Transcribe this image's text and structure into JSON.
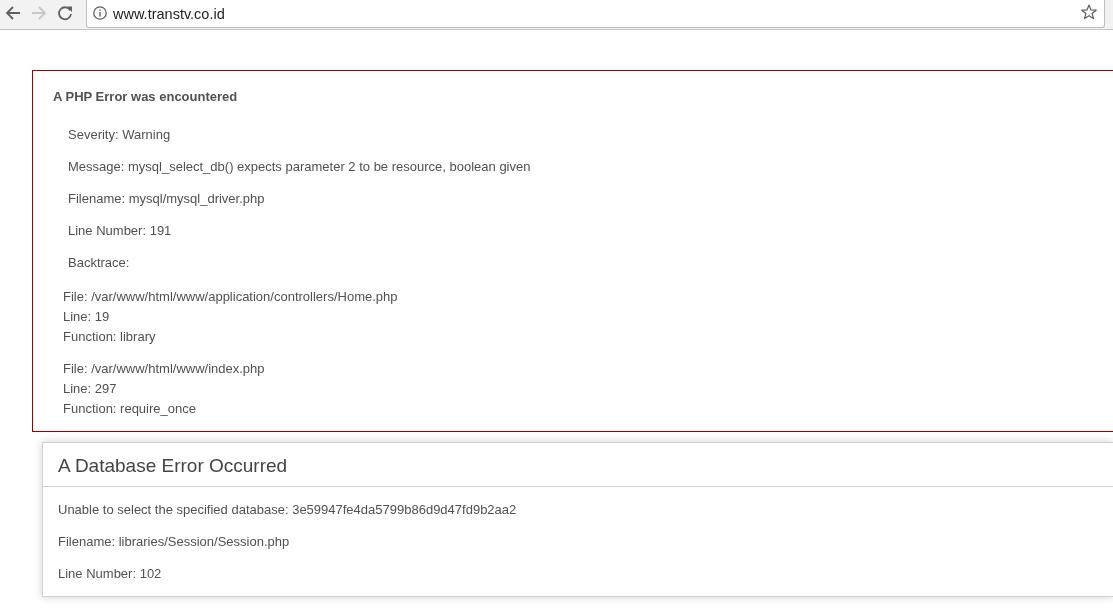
{
  "browser": {
    "nav_buttons": [
      {
        "kind": "back",
        "disabled": false
      },
      {
        "kind": "forward",
        "disabled": true
      },
      {
        "kind": "reload",
        "disabled": false
      }
    ],
    "url": "www.transtv.co.id"
  },
  "php_error": {
    "title": "A PHP Error was encountered",
    "details": [
      "Severity: Warning",
      "Message: mysql_select_db() expects parameter 2 to be resource, boolean given",
      "Filename: mysql/mysql_driver.php",
      "Line Number: 191",
      "Backtrace:"
    ],
    "backtrace": [
      {
        "lines": [
          "File: /var/www/html/www/application/controllers/Home.php",
          "Line: 19",
          "Function: library"
        ]
      },
      {
        "lines": [
          "File: /var/www/html/www/index.php",
          "Line: 297",
          "Function: require_once"
        ]
      }
    ]
  },
  "database_error": {
    "title": "A Database Error Occurred",
    "lines": [
      "Unable to select the specified database: 3e59947fe4da5799b86d9d47fd9b2aa2",
      "Filename: libraries/Session/Session.php",
      "Line Number: 102"
    ]
  }
}
